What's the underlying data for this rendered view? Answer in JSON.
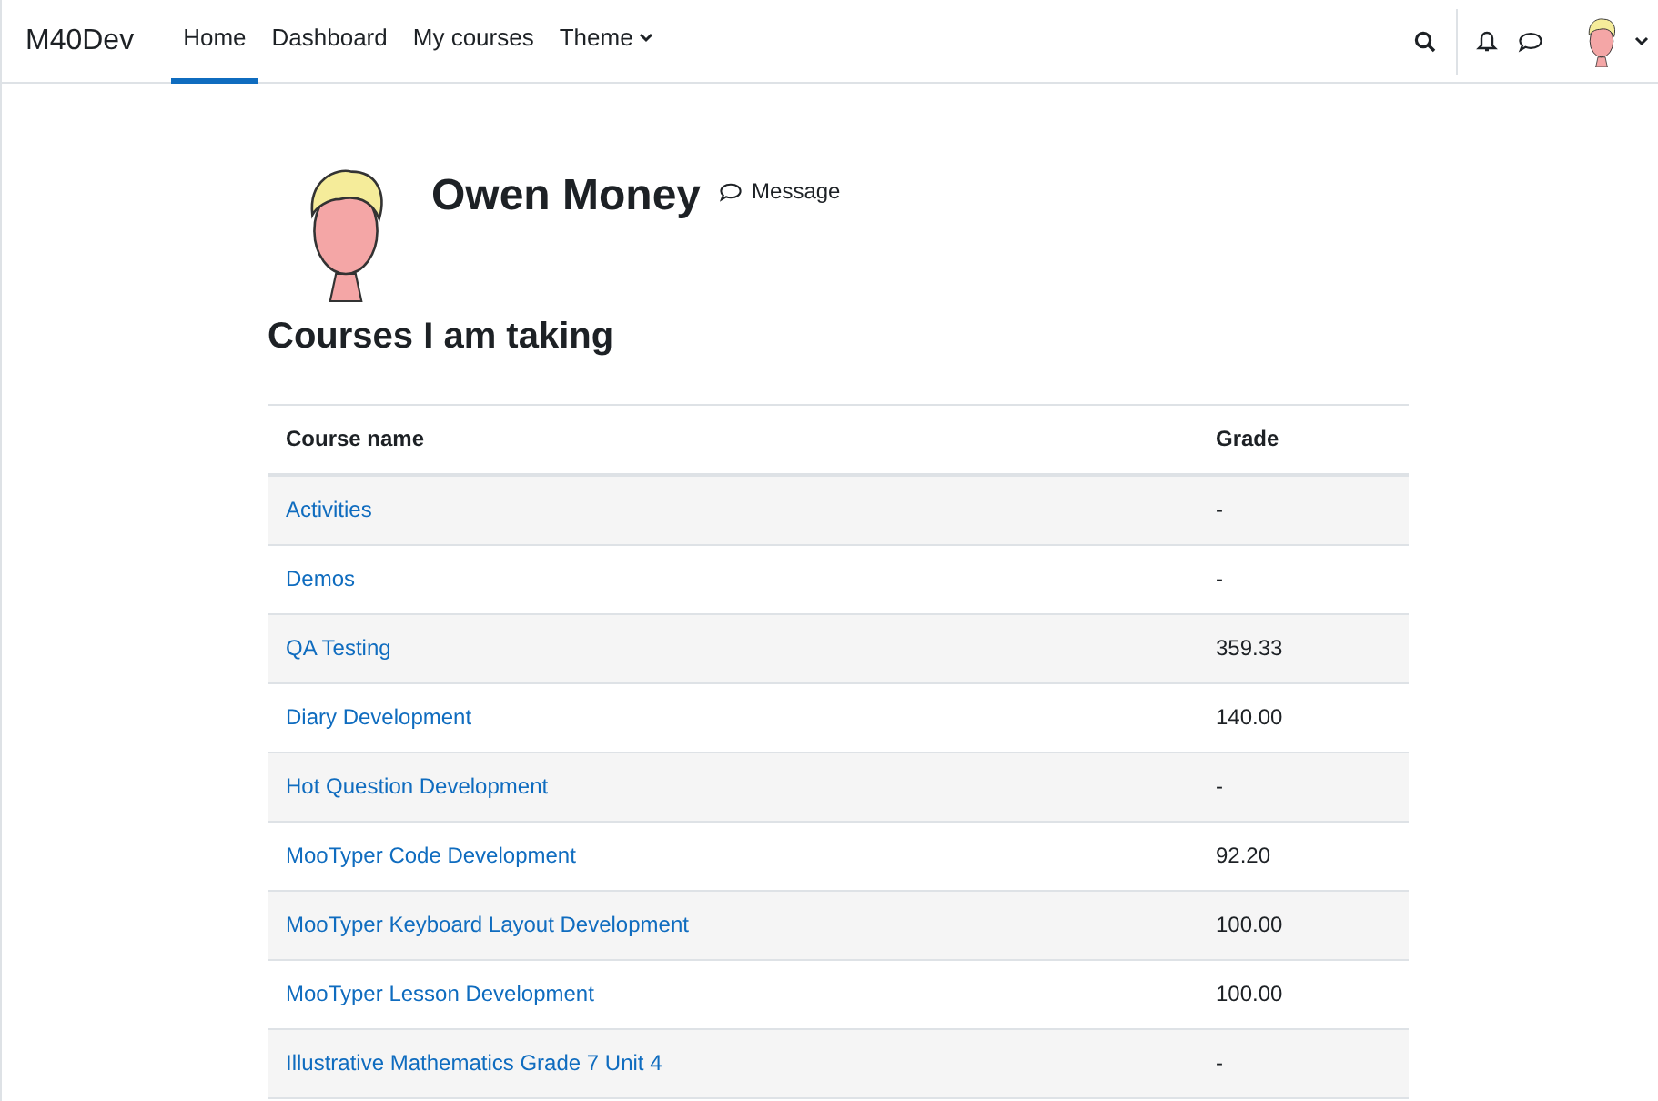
{
  "navbar": {
    "brand": "M40Dev",
    "links": [
      {
        "label": "Home",
        "selected": true,
        "dropdown": false
      },
      {
        "label": "Dashboard",
        "selected": false,
        "dropdown": false
      },
      {
        "label": "My courses",
        "selected": false,
        "dropdown": false
      },
      {
        "label": "Theme",
        "selected": false,
        "dropdown": true
      }
    ]
  },
  "profile": {
    "name": "Owen Money",
    "message": "Message"
  },
  "heading": "Courses I am taking",
  "table": {
    "columns": [
      "Course name",
      "Grade"
    ],
    "rows": [
      {
        "course": "Activities",
        "grade": "-"
      },
      {
        "course": "Demos",
        "grade": "-"
      },
      {
        "course": "QA Testing",
        "grade": "359.33"
      },
      {
        "course": "Diary Development",
        "grade": "140.00"
      },
      {
        "course": "Hot Question Development",
        "grade": "-"
      },
      {
        "course": "MooTyper Code Development",
        "grade": "92.20"
      },
      {
        "course": "MooTyper Keyboard Layout Development",
        "grade": "100.00"
      },
      {
        "course": "MooTyper Lesson Development",
        "grade": "100.00"
      },
      {
        "course": "Illustrative Mathematics Grade 7 Unit 4",
        "grade": "-"
      }
    ]
  }
}
